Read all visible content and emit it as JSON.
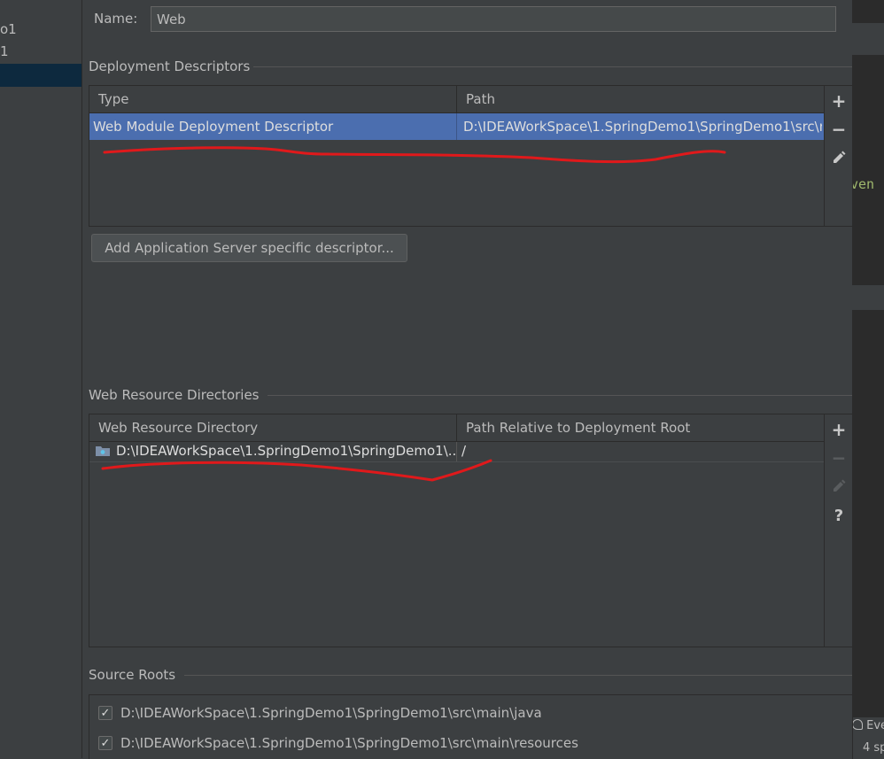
{
  "left_panel": {
    "items": [
      "o1",
      "1"
    ]
  },
  "right_strip": {
    "text_event": "ven",
    "text_events": "Eve",
    "text_spaces": "4 sp"
  },
  "name": {
    "label": "Name:",
    "value": "Web"
  },
  "deployment_descriptors": {
    "title": "Deployment Descriptors",
    "columns": [
      "Type",
      "Path"
    ],
    "rows": [
      {
        "type": "Web Module Deployment Descriptor",
        "path": "D:\\IDEAWorkSpace\\1.SpringDemo1\\SpringDemo1\\src\\m"
      }
    ],
    "add_server_button": "Add Application Server specific descriptor..."
  },
  "web_resource_directories": {
    "title": "Web Resource Directories",
    "columns": [
      "Web Resource Directory",
      "Path Relative to Deployment Root"
    ],
    "rows": [
      {
        "directory": "D:\\IDEAWorkSpace\\1.SpringDemo1\\SpringDemo1\\...",
        "relative_path": "/"
      }
    ]
  },
  "source_roots": {
    "title": "Source Roots",
    "items": [
      {
        "checked": true,
        "path": "D:\\IDEAWorkSpace\\1.SpringDemo1\\SpringDemo1\\src\\main\\java"
      },
      {
        "checked": true,
        "path": "D:\\IDEAWorkSpace\\1.SpringDemo1\\SpringDemo1\\src\\main\\resources"
      }
    ]
  },
  "toolbar_icons": {
    "add": "plus-icon",
    "remove": "minus-icon",
    "edit": "pencil-icon",
    "help": "question-icon"
  },
  "colors": {
    "background": "#3c3f41",
    "selection": "#4b6eaf",
    "tree_selection": "#0d293e",
    "annotation": "#e0191b",
    "text": "#bbbbbb"
  }
}
